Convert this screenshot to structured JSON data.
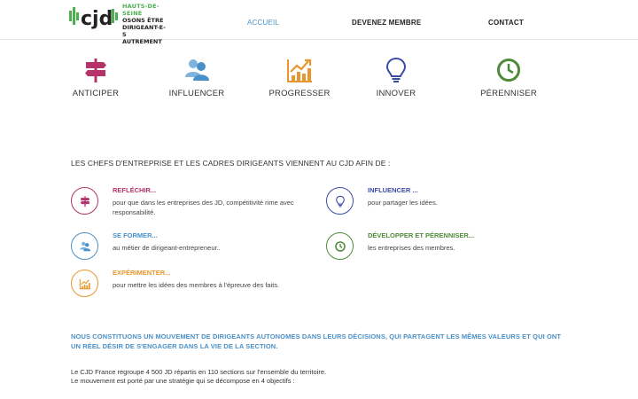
{
  "header": {
    "logo": {
      "mark": "cjd",
      "line1": "HAUTS-DE-SEINE",
      "line2": "OSONS ÊTRE",
      "line3": "DIRIGEANT-E-S",
      "line4": "AUTREMENT"
    },
    "nav": {
      "accueil": "ACCUEIL",
      "membre": "DEVENEZ MEMBRE",
      "contact": "CONTACT"
    }
  },
  "pillars": [
    {
      "label": "ANTICIPER",
      "icon": "signpost-icon",
      "color": "#b5336a"
    },
    {
      "label": "INFLUENCER",
      "icon": "people-icon",
      "color": "#4a90c8"
    },
    {
      "label": "PROGRESSER",
      "icon": "growth-chart-icon",
      "color": "#e8962e"
    },
    {
      "label": "INNOVER",
      "icon": "lightbulb-icon",
      "color": "#3b4ba8"
    },
    {
      "label": "PÉRENNISER",
      "icon": "clock-icon",
      "color": "#4e8a3a"
    }
  ],
  "intro": {
    "title": "LES CHEFS D'ENTREPRISE ET LES CADRES DIRIGEANTS VIENNENT AU CJD AFIN DE :"
  },
  "goals": {
    "reflechir": {
      "title": "REFLÉCHIR...",
      "text": "pour que dans les entreprises des JD, compétitivité rime avec responsabilité.",
      "color": "#b5336a"
    },
    "influencer": {
      "title": "INFLUENCER ...",
      "text": "pour partager les idées.",
      "color": "#3b4ba8"
    },
    "former": {
      "title": "SE FORMER...",
      "text": "au métier de dirigeant-entrepreneur..",
      "color": "#4a90c8"
    },
    "perenniser": {
      "title": "DÉVELOPPER ET PÉRENNISER...",
      "text": "les entreprises des membres.",
      "color": "#4e8a3a"
    },
    "experimenter": {
      "title": "EXPÉRIMENTER...",
      "text": "pour mettre les idées des membres à l'épreuve des faits.",
      "color": "#e8962e"
    }
  },
  "movement": "NOUS CONSTITUONS UN MOUVEMENT DE DIRIGEANTS AUTONOMES DANS LEURS DÉCISIONS, QUI PARTAGENT LES MÊMES VALEURS ET QUI ONT UN RÉEL DÉSIR DE S'ENGAGER DANS LA VIE DE LA SECTION.",
  "paragraph": {
    "line1": "Le CJD France regroupe 4 500 JD répartis en 110 sections sur l'ensemble du territoire.",
    "line2": "Le mouvement est porté par une stratégie qui se décompose en 4 objectifs :"
  }
}
